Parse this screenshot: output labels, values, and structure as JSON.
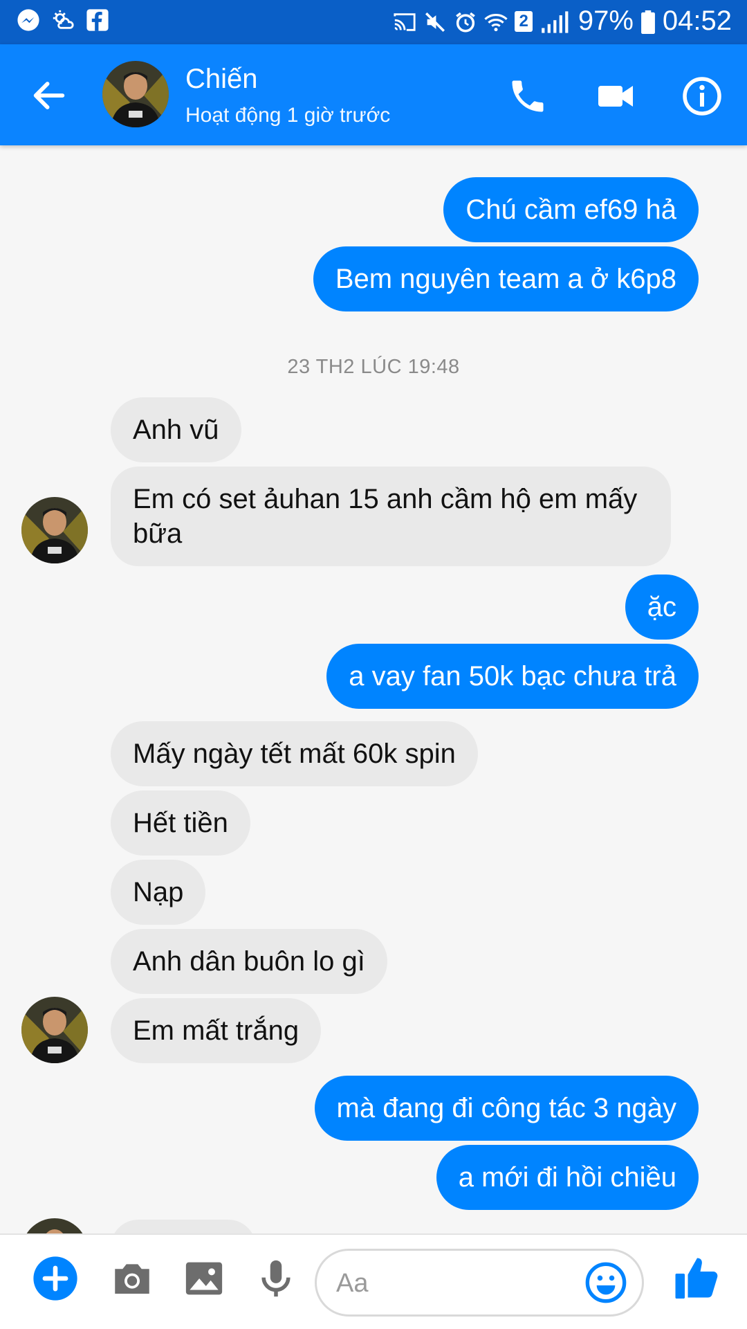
{
  "status_bar": {
    "battery": "97%",
    "time": "04:52",
    "sim_badge": "2",
    "icons_left": [
      "messenger-icon",
      "weather-icon",
      "facebook-icon"
    ],
    "icons_right": [
      "cast-icon",
      "mute-icon",
      "alarm-icon",
      "wifi-icon",
      "signal-icon",
      "battery-icon"
    ]
  },
  "header": {
    "name": "Chiến",
    "status": "Hoạt động 1 giờ trước",
    "buttons": [
      "back-arrow-icon",
      "phone-icon",
      "video-camera-icon",
      "info-icon"
    ],
    "accent_color": "#0084ff"
  },
  "timestamp": "23 TH2 LÚC 19:48",
  "messages": [
    {
      "dir": "out",
      "text": "Chú cầm ef69 hả"
    },
    {
      "dir": "out",
      "text": "Bem nguyên team a ở k6p8"
    },
    {
      "dir": "in",
      "text": "Anh vũ"
    },
    {
      "dir": "in",
      "text": "Em  có set ảuhan 15 anh cầm hộ em mấy bữa"
    },
    {
      "dir": "out",
      "text": "ặc"
    },
    {
      "dir": "out",
      "text": "a vay fan 50k bạc chưa trả"
    },
    {
      "dir": "in",
      "text": "Mấy ngày tết mất 60k spin"
    },
    {
      "dir": "in",
      "text": "Hết tiền"
    },
    {
      "dir": "in",
      "text": "Nạp"
    },
    {
      "dir": "in",
      "text": "Anh dân buôn lo gì"
    },
    {
      "dir": "in",
      "text": "Em mất trắng"
    },
    {
      "dir": "out",
      "text": "mà đang đi công tác 3 ngày"
    },
    {
      "dir": "out",
      "text": "a mới đi hồi chiều"
    }
  ],
  "composer": {
    "placeholder": "Aa",
    "buttons": [
      "plus-icon",
      "camera-icon",
      "gallery-icon",
      "microphone-icon",
      "emoji-icon",
      "thumbs-up-icon"
    ]
  },
  "colors": {
    "status_bar": "#0a5fc7",
    "header": "#0b84ff",
    "outgoing_bubble": "#0084ff",
    "incoming_bubble": "#e9e9e9"
  }
}
